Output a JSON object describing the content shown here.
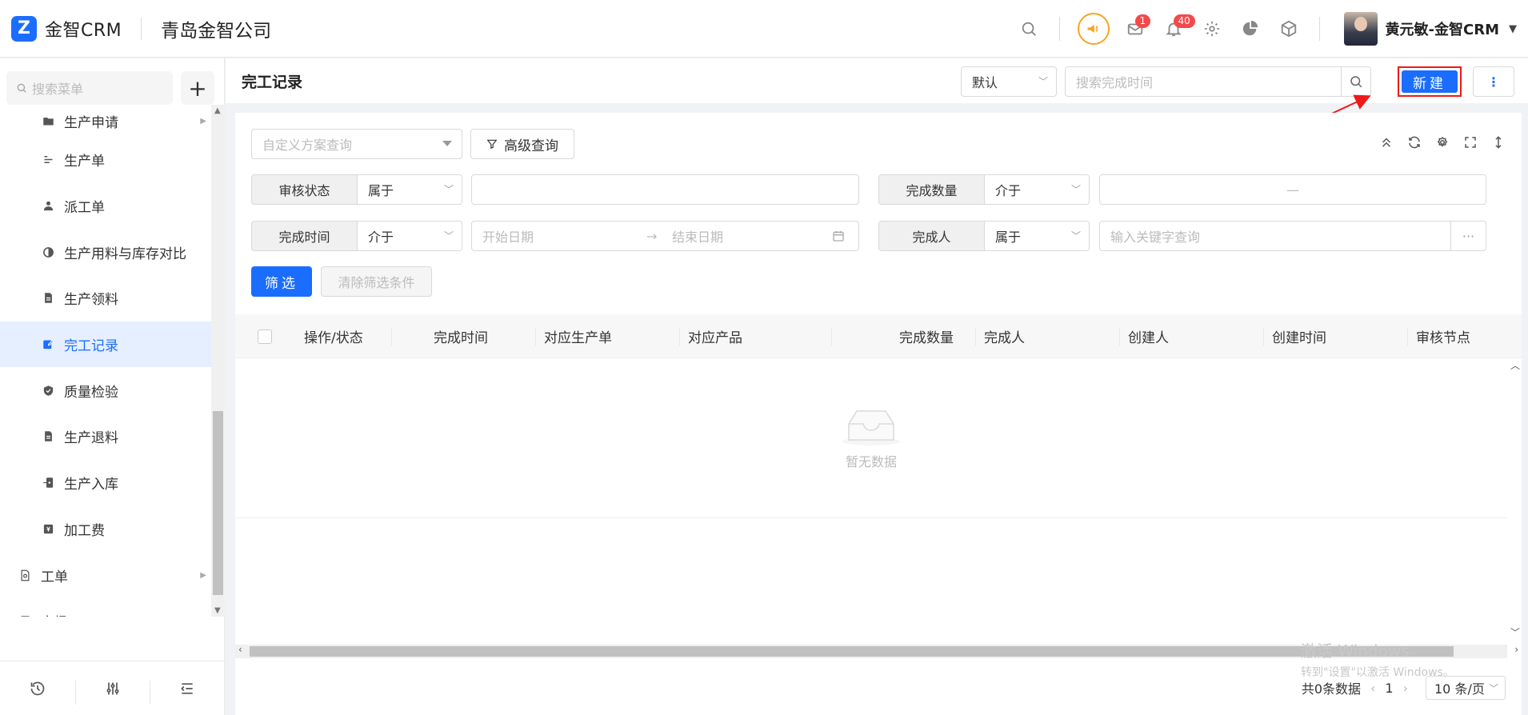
{
  "topbar": {
    "logo_text": "金智CRM",
    "company": "青岛金智公司",
    "msg_badge": "1",
    "notice_badge": "40",
    "username": "黄元敏-金智CRM"
  },
  "sidebar": {
    "search_placeholder": "搜索菜单",
    "add_label": "+",
    "items": [
      {
        "label": "生产申请",
        "icon": "folder-icon"
      },
      {
        "label": "生产单",
        "icon": "list-icon"
      },
      {
        "label": "派工单",
        "icon": "worker-icon"
      },
      {
        "label": "生产用料与库存对比",
        "icon": "contrast-icon"
      },
      {
        "label": "生产领料",
        "icon": "document-icon"
      },
      {
        "label": "完工记录",
        "icon": "edit-icon"
      },
      {
        "label": "质量检验",
        "icon": "shield-icon"
      },
      {
        "label": "生产退料",
        "icon": "document-icon"
      },
      {
        "label": "生产入库",
        "icon": "import-icon"
      },
      {
        "label": "加工费",
        "icon": "fee-icon"
      },
      {
        "label": "工单",
        "icon": "ticket-icon"
      },
      {
        "label": "市场",
        "icon": "bookmark-icon"
      }
    ]
  },
  "header": {
    "title": "完工记录",
    "view_select": "默认",
    "search_placeholder": "搜索完成时间",
    "new_label": "新建",
    "more_label": "⋮"
  },
  "filters": {
    "scheme_placeholder": "自定义方案查询",
    "advanced_label": "高级查询",
    "rows": [
      {
        "label": "审核状态",
        "op": "属于"
      },
      {
        "label": "完成数量",
        "op": "介于",
        "range_sep": "—"
      },
      {
        "label": "完成时间",
        "op": "介于",
        "start_placeholder": "开始日期",
        "end_placeholder": "结束日期"
      },
      {
        "label": "完成人",
        "op": "属于",
        "placeholder": "输入关键字查询",
        "more": "···"
      }
    ],
    "filter_btn": "筛选",
    "clear_btn": "清除筛选条件"
  },
  "table": {
    "columns": [
      "操作/状态",
      "完成时间",
      "对应生产单",
      "对应产品",
      "完成数量",
      "完成人",
      "创建人",
      "创建时间",
      "审核节点"
    ],
    "empty_text": "暂无数据"
  },
  "pager": {
    "total": "共0条数据",
    "page": "1",
    "page_size": "10 条/页"
  },
  "watermark": {
    "line1": "激活 Windows",
    "line2": "转到\"设置\"以激活 Windows。"
  },
  "colors": {
    "primary": "#1a6dff",
    "badge": "#f5484a",
    "highlight_box": "#f01818",
    "promo": "#f5a623"
  }
}
